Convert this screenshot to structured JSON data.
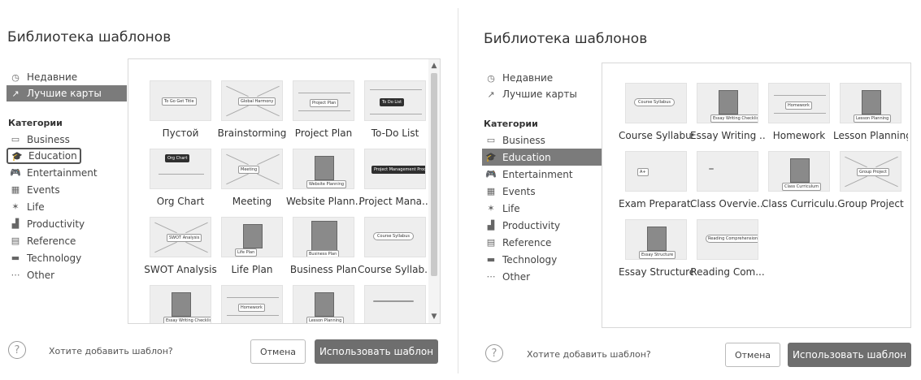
{
  "left": {
    "title": "Библиотека шаблонов",
    "nav": [
      {
        "label": "Недавние",
        "icon": "clock-icon",
        "glyph": "◷",
        "selected": false
      },
      {
        "label": "Лучшие карты",
        "icon": "trending-icon",
        "glyph": "↗",
        "selected": true
      }
    ],
    "categories_heading": "Категории",
    "categories": [
      {
        "label": "Business",
        "icon": "briefcase-icon",
        "glyph": "▭"
      },
      {
        "label": "Education",
        "icon": "graduation-cap-icon",
        "glyph": "🎓",
        "outlined": true
      },
      {
        "label": "Entertainment",
        "icon": "gamepad-icon",
        "glyph": "🎮"
      },
      {
        "label": "Events",
        "icon": "calendar-icon",
        "glyph": "▦"
      },
      {
        "label": "Life",
        "icon": "person-icon",
        "glyph": "✶"
      },
      {
        "label": "Productivity",
        "icon": "bar-chart-icon",
        "glyph": "▟"
      },
      {
        "label": "Reference",
        "icon": "book-icon",
        "glyph": "▤"
      },
      {
        "label": "Technology",
        "icon": "laptop-icon",
        "glyph": "▬"
      },
      {
        "label": "Other",
        "icon": "ellipsis-icon",
        "glyph": "⋯"
      }
    ],
    "templates": [
      {
        "label": "Пустой",
        "node": "To Go Get Title"
      },
      {
        "label": "Brainstorming",
        "node": "Global Harmony"
      },
      {
        "label": "Project Plan",
        "node": "Project Plan"
      },
      {
        "label": "To-Do List",
        "node": "To Do List"
      },
      {
        "label": "Org Chart",
        "node": "Org Chart"
      },
      {
        "label": "Meeting",
        "node": "Meeting"
      },
      {
        "label": "Website Plann...",
        "node": "Website Planning"
      },
      {
        "label": "Project Mana...",
        "node": "Project Management Process"
      },
      {
        "label": "SWOT Analysis",
        "node": "SWOT Analysis"
      },
      {
        "label": "Life Plan",
        "node": "Life Plan"
      },
      {
        "label": "Business Plan",
        "node": "Business Plan"
      },
      {
        "label": "Course Syllab...",
        "node": "Course Syllabus"
      },
      {
        "label": "",
        "node": "Essay Writing Checklist"
      },
      {
        "label": "",
        "node": "Homework"
      },
      {
        "label": "",
        "node": "Lesson Planning"
      },
      {
        "label": "",
        "node": ""
      }
    ],
    "help_text": "Хотите добавить шаблон?",
    "cancel": "Отмена",
    "use": "Использовать шаблон"
  },
  "right": {
    "title": "Библиотека шаблонов",
    "nav": [
      {
        "label": "Недавние",
        "icon": "clock-icon",
        "glyph": "◷",
        "selected": false
      },
      {
        "label": "Лучшие карты",
        "icon": "trending-icon",
        "glyph": "↗",
        "selected": false
      }
    ],
    "categories_heading": "Категории",
    "categories": [
      {
        "label": "Business",
        "icon": "briefcase-icon",
        "glyph": "▭"
      },
      {
        "label": "Education",
        "icon": "graduation-cap-icon",
        "glyph": "🎓",
        "selected": true
      },
      {
        "label": "Entertainment",
        "icon": "gamepad-icon",
        "glyph": "🎮"
      },
      {
        "label": "Events",
        "icon": "calendar-icon",
        "glyph": "▦"
      },
      {
        "label": "Life",
        "icon": "person-icon",
        "glyph": "✶"
      },
      {
        "label": "Productivity",
        "icon": "bar-chart-icon",
        "glyph": "▟"
      },
      {
        "label": "Reference",
        "icon": "book-icon",
        "glyph": "▤"
      },
      {
        "label": "Technology",
        "icon": "laptop-icon",
        "glyph": "▬"
      },
      {
        "label": "Other",
        "icon": "ellipsis-icon",
        "glyph": "⋯"
      }
    ],
    "templates": [
      {
        "label": "Course Syllabus",
        "node": "Course Syllabus"
      },
      {
        "label": "Essay Writing ...",
        "node": "Essay Writing Checklist"
      },
      {
        "label": "Homework",
        "node": "Homework"
      },
      {
        "label": "Lesson Planning",
        "node": "Lesson Planning"
      },
      {
        "label": "Exam Preparat...",
        "node": "A+"
      },
      {
        "label": "Class Overvie...",
        "node": ""
      },
      {
        "label": "Class Curriculu...",
        "node": "Class Curriculum"
      },
      {
        "label": "Group Project",
        "node": "Group Project"
      },
      {
        "label": "Essay Structure",
        "node": "Essay Structure"
      },
      {
        "label": "Reading Com...",
        "node": "Reading Comprehension Template"
      }
    ],
    "help_text": "Хотите добавить шаблон?",
    "cancel": "Отмена",
    "use": "Использовать шаблон"
  }
}
